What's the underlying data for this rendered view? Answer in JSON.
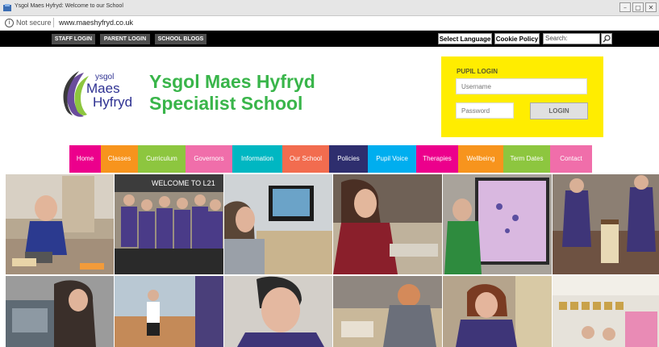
{
  "window": {
    "title": "Ysgol Maes Hyfryd: Welcome to our School",
    "controls": [
      "–",
      "▢",
      "✕"
    ]
  },
  "address_bar": {
    "security": "Not secure",
    "url": "www.maeshyfryd.co.uk"
  },
  "topbar": {
    "buttons": [
      "STAFF LOGIN",
      "PARENT LOGIN",
      "SCHOOL BLOGS"
    ],
    "select_language": "Select Language",
    "cookie_policy": "Cookie Policy",
    "search_value": "Search:"
  },
  "logo": {
    "line1": "ysgol",
    "line2": "Maes",
    "line3": "Hyfryd"
  },
  "school_name": {
    "line1": "Ysgol Maes Hyfryd",
    "line2": "Specialist School"
  },
  "pupil_login": {
    "label": "PUPIL LOGIN",
    "username_placeholder": "Username",
    "password_placeholder": "Password",
    "button": "LOGIN"
  },
  "nav": [
    {
      "label": "Home",
      "color": "#ec008c"
    },
    {
      "label": "Classes",
      "color": "#f7941d"
    },
    {
      "label": "Curriculum",
      "color": "#8dc63f"
    },
    {
      "label": "Governors",
      "color": "#f06eaa"
    },
    {
      "label": "Information",
      "color": "#00b7c2"
    },
    {
      "label": "Our School",
      "color": "#f26c4f"
    },
    {
      "label": "Policies",
      "color": "#2e2e6e"
    },
    {
      "label": "Pupil Voice",
      "color": "#00aeef"
    },
    {
      "label": "Therapies",
      "color": "#ec008c"
    },
    {
      "label": "Wellbeing",
      "color": "#f7941d"
    },
    {
      "label": "Term Dates",
      "color": "#8dc63f"
    },
    {
      "label": "Contact",
      "color": "#f06eaa"
    }
  ],
  "photo_sign_text": "WELCOME TO L21",
  "colors": {
    "brand_green": "#39b54a",
    "brand_navy": "#2e3192",
    "login_yellow": "#ffed00"
  }
}
